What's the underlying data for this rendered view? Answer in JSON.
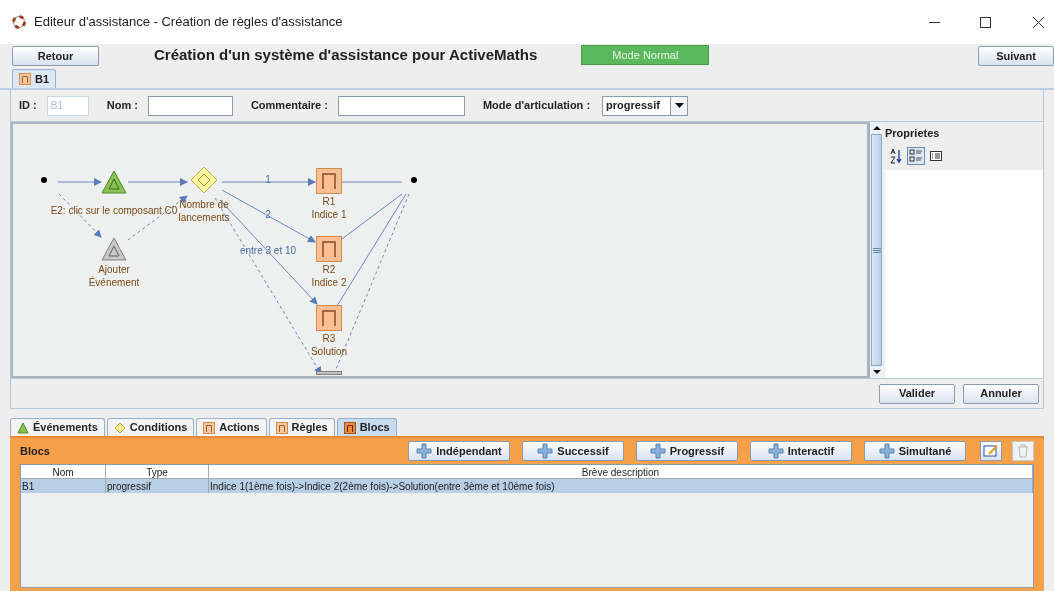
{
  "window": {
    "title": "Editeur d'assistance - Création de règles d'assistance"
  },
  "toolbar": {
    "back_button": "Retour",
    "heading": "Création d'un système d'assistance pour ActiveMaths",
    "mode_indicator": "Mode Normal",
    "next_button": "Suivant"
  },
  "editor_tabs": [
    {
      "label": "B1",
      "selected": true
    }
  ],
  "form": {
    "fields": [
      {
        "label": "ID :",
        "value": "B1",
        "disabled": true
      },
      {
        "label": "Nom :",
        "disabled": false
      },
      {
        "label": "Commentaire :",
        "disabled": false
      }
    ],
    "mode": {
      "label": "Mode d'articulation :",
      "value": "progressif"
    }
  },
  "diagram": {
    "nodes": [
      {
        "kind": "start"
      },
      {
        "kind": "event",
        "lines": [
          "E2: clic sur le composant C0"
        ]
      },
      {
        "kind": "event_placeholder",
        "lines": [
          "Ajouter",
          "Événement"
        ]
      },
      {
        "kind": "condition",
        "lines": [
          "Nombre de",
          "lancements"
        ]
      },
      {
        "kind": "rule",
        "lines": [
          "R1",
          "Indice 1"
        ]
      },
      {
        "kind": "rule",
        "lines": [
          "R2",
          "Indice 2"
        ]
      },
      {
        "kind": "rule",
        "lines": [
          "R3",
          "Solution"
        ]
      },
      {
        "kind": "end"
      },
      {
        "kind": "rule_placeholder"
      }
    ],
    "edge_labels": [
      "1",
      "2",
      "entre 3 et 10"
    ]
  },
  "properties": {
    "title": "Proprietes"
  },
  "dialog_buttons": [
    "Valider",
    "Annuler"
  ],
  "bottom_tabs": [
    {
      "label": "Événements",
      "kind": "event",
      "selected": false
    },
    {
      "label": "Conditions",
      "kind": "condition",
      "selected": false
    },
    {
      "label": "Actions",
      "kind": "rule",
      "selected": false
    },
    {
      "label": "Règles",
      "kind": "rule",
      "selected": false
    },
    {
      "label": "Blocs",
      "kind": "block",
      "selected": true
    }
  ],
  "blocks_panel": {
    "title": "Blocs",
    "add_buttons": [
      "Indépendant",
      "Successif",
      "Progressif",
      "Interactif",
      "Simultané"
    ],
    "delete_disabled": true,
    "table": {
      "columns": [
        "Nom",
        "Type",
        "Brève description"
      ],
      "rows": [
        {
          "cells": [
            "B1",
            "progressif",
            "Indice 1(1ème fois)->Indice 2(2ème fois)->Solution(entre 3ème et 10ème fois)"
          ],
          "selected": true
        }
      ]
    }
  }
}
